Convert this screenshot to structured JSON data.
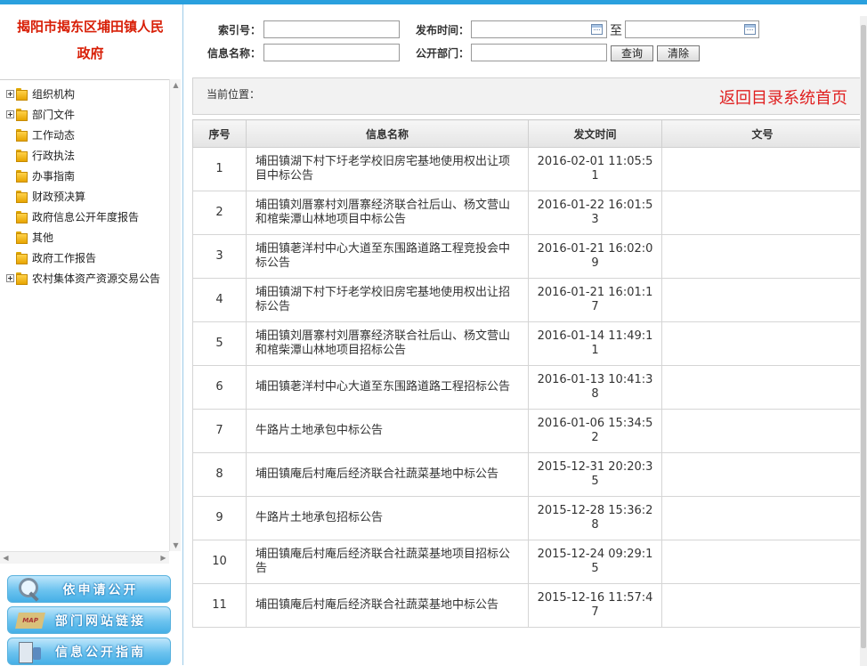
{
  "site": {
    "title_line1": "揭阳市揭东区埔田镇人民",
    "title_line2": "政府"
  },
  "tree": [
    {
      "label": "组织机构",
      "expandable": true
    },
    {
      "label": "部门文件",
      "expandable": true
    },
    {
      "label": "工作动态",
      "expandable": false
    },
    {
      "label": "行政执法",
      "expandable": false
    },
    {
      "label": "办事指南",
      "expandable": false
    },
    {
      "label": "财政预决算",
      "expandable": false
    },
    {
      "label": "政府信息公开年度报告",
      "expandable": false
    },
    {
      "label": "其他",
      "expandable": false
    },
    {
      "label": "政府工作报告",
      "expandable": false
    },
    {
      "label": "农村集体资产资源交易公告",
      "expandable": true
    }
  ],
  "side_buttons": {
    "apply": "依申请公开",
    "links": "部门网站链接",
    "guide": "信息公开指南"
  },
  "search": {
    "index_label": "索引号：",
    "date_label": "发布时间：",
    "to": "至",
    "name_label": "信息名称：",
    "dept_label": "公开部门：",
    "query": "查询",
    "clear": "清除"
  },
  "location": {
    "label": "当前位置：",
    "back": "返回目录系统首页"
  },
  "table": {
    "headers": {
      "num": "序号",
      "name": "信息名称",
      "date": "发文时间",
      "doc": "文号"
    },
    "rows": [
      {
        "num": "1",
        "name": "埔田镇湖下村下圩老学校旧房宅基地使用权出让项目中标公告",
        "date": "2016-02-01 11:05:51",
        "doc": ""
      },
      {
        "num": "2",
        "name": "埔田镇刘厝寨村刘厝寨经济联合社后山、杨文营山和棺柴潭山林地项目中标公告",
        "date": "2016-01-22 16:01:53",
        "doc": ""
      },
      {
        "num": "3",
        "name": "埔田镇荖洋村中心大道至东围路道路工程竞投会中标公告",
        "date": "2016-01-21 16:02:09",
        "doc": ""
      },
      {
        "num": "4",
        "name": "埔田镇湖下村下圩老学校旧房宅基地使用权出让招标公告",
        "date": "2016-01-21 16:01:17",
        "doc": ""
      },
      {
        "num": "5",
        "name": "埔田镇刘厝寨村刘厝寨经济联合社后山、杨文营山和棺柴潭山林地项目招标公告",
        "date": "2016-01-14 11:49:11",
        "doc": ""
      },
      {
        "num": "6",
        "name": "埔田镇荖洋村中心大道至东围路道路工程招标公告",
        "date": "2016-01-13 10:41:38",
        "doc": ""
      },
      {
        "num": "7",
        "name": "牛路片土地承包中标公告",
        "date": "2016-01-06 15:34:52",
        "doc": ""
      },
      {
        "num": "8",
        "name": "埔田镇庵后村庵后经济联合社蔬菜基地中标公告",
        "date": "2015-12-31 20:20:35",
        "doc": ""
      },
      {
        "num": "9",
        "name": "牛路片土地承包招标公告",
        "date": "2015-12-28 15:36:28",
        "doc": ""
      },
      {
        "num": "10",
        "name": "埔田镇庵后村庵后经济联合社蔬菜基地项目招标公告",
        "date": "2015-12-24 09:29:15",
        "doc": ""
      },
      {
        "num": "11",
        "name": "埔田镇庵后村庵后经济联合社蔬菜基地中标公告",
        "date": "2015-12-16 11:57:47",
        "doc": ""
      }
    ]
  }
}
